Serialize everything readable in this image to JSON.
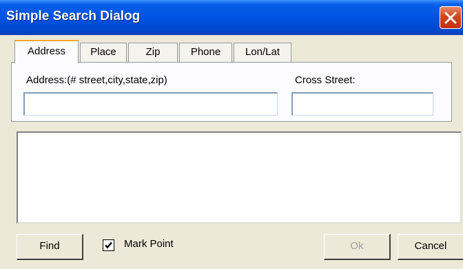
{
  "window": {
    "title": "Simple Search Dialog"
  },
  "tabs": [
    {
      "label": "Address",
      "active": true
    },
    {
      "label": "Place",
      "active": false
    },
    {
      "label": "Zip",
      "active": false
    },
    {
      "label": "Phone",
      "active": false
    },
    {
      "label": "Lon/Lat",
      "active": false
    }
  ],
  "address": {
    "label": "Address:(# street,city,state,zip)",
    "value": ""
  },
  "cross_street": {
    "label": "Cross Street:",
    "value": ""
  },
  "results": [],
  "buttons": {
    "find_label": "Find",
    "ok_label": "Ok",
    "cancel_label": "Cancel"
  },
  "mark_point": {
    "label": "Mark Point",
    "checked": true
  },
  "icons": {
    "close": "close-icon",
    "check": "checkmark-icon"
  }
}
